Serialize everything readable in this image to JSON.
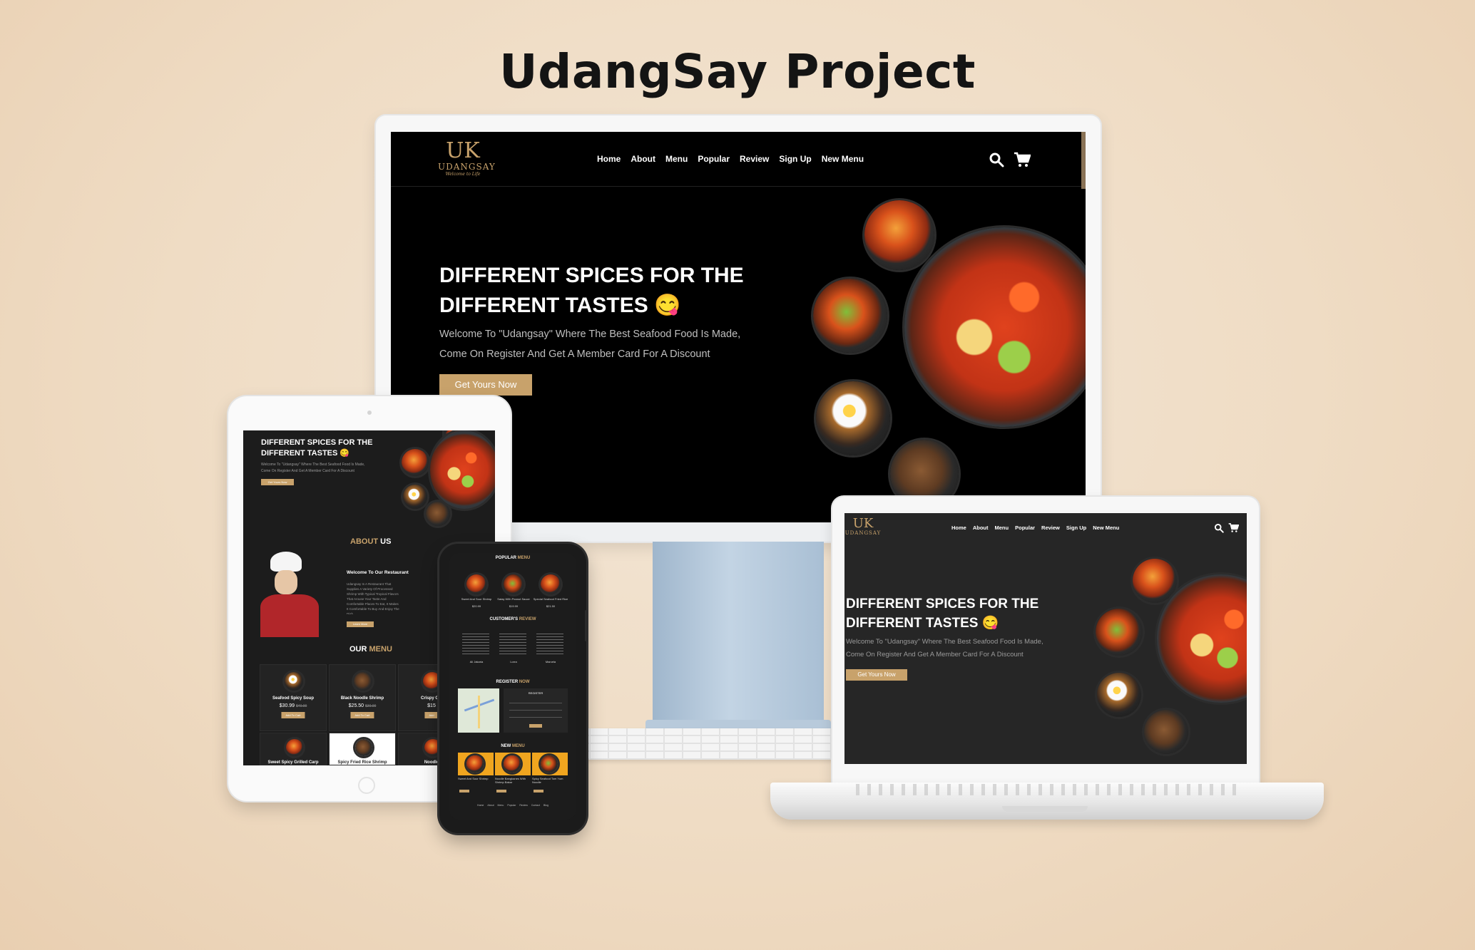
{
  "title": "UdangSay Project",
  "brand": {
    "name": "UDANGSAY",
    "glyph": "UK",
    "tagline": "Welcome to Life",
    "accent": "#c8a26b",
    "dark": "#000000"
  },
  "nav": [
    "Home",
    "About",
    "Menu",
    "Popular",
    "Review",
    "Sign Up",
    "New Menu"
  ],
  "hero": {
    "heading_line1": "DIFFERENT SPICES FOR THE",
    "heading_line2": "DIFFERENT TASTES",
    "emoji": "😋",
    "desc_line1": "Welcome To \"Udangsay\" Where The Best Seafood Food Is Made,",
    "desc_line2": "Come On Register And Get A Member Card For A Discount",
    "cta": "Get Yours Now"
  },
  "icons": [
    "search-icon",
    "cart-icon"
  ],
  "tablet": {
    "about_title_accent": "ABOUT",
    "about_title_rest": " US",
    "about_heading": "Welcome To Our Restaurant",
    "about_text": "Udangsay Is A Restaurant That Supplies A Variety Of Processed Shrimp With Typical Tropical Flavors That Arouse Your Taste And Comfortable Places To Eat, It Makes It Comfortable To Buy And Enjoy The Dish",
    "about_button": "Learn More",
    "menu_title_plain": "OUR ",
    "menu_title_accent": "MENU",
    "menu_items": [
      {
        "name": "Seafood Spicy Soup",
        "price": "$30.99",
        "old": "$40.00",
        "button": "Add To Cart"
      },
      {
        "name": "Black Noodle Shrimp",
        "price": "$25.50",
        "old": "$30.00",
        "button": "Add To Cart"
      },
      {
        "name": "Crispy Chi",
        "price": "$15",
        "old": "",
        "button": "Add"
      }
    ],
    "menu_row2": [
      "Sweet Spicy Grilled Carp",
      "Spicy Fried Rice Shrimp",
      "Noodle"
    ]
  },
  "phone": {
    "popular_title_plain": "POPULAR ",
    "popular_title_accent": "MENU",
    "popular_items": [
      {
        "name": "Sweet And Sour Shrimp",
        "price": "$20.99"
      },
      {
        "name": "Satay With Peanut Sauce",
        "price": "$19.99"
      },
      {
        "name": "Special Seafood Fried Rice",
        "price": "$21.50"
      }
    ],
    "review_title_plain": "CUSTOMER'S ",
    "review_title_accent": "REVIEW",
    "reviewers": [
      "Ali Jakaria",
      "Lorra",
      "Marcela"
    ],
    "register_title_plain": "REGISTER ",
    "register_title_accent": "NOW",
    "register_form_title": "REGISTER",
    "new_title_plain": "NEW ",
    "new_title_accent": "MENU",
    "new_items": [
      "Sweet And Sour Shrimp",
      "Noodle Bangkanes With Shrimp Bakar",
      "Spicy Seafood Tom Yum Noodle"
    ],
    "footer_links": [
      "Home",
      "About",
      "Menu",
      "Popular",
      "Review",
      "Contact",
      "Blog"
    ]
  }
}
